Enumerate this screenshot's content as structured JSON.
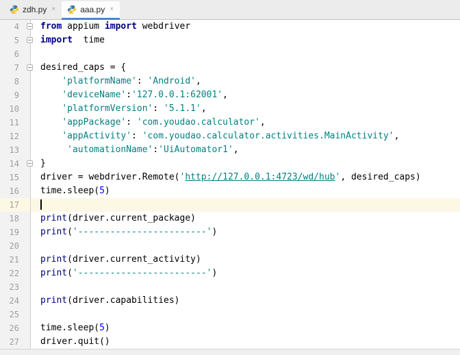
{
  "tab_bar": {
    "close_glyph": "×",
    "tabs": [
      {
        "label": "zdh.py",
        "icon": "python-file-icon",
        "active": false
      },
      {
        "label": "aaa.py",
        "icon": "python-file-icon",
        "active": true
      }
    ]
  },
  "colors": {
    "keyword": "#000080",
    "string": "#008080",
    "number": "#0000ff",
    "plain_text": "#000000",
    "line_number": "#9e9e9e",
    "current_line_bg": "#fcf8e3",
    "tab_underline": "#4a87c7",
    "tab_bar_bg": "#ececec",
    "gutter_bg": "#f2f2f2"
  },
  "editor": {
    "first_line_number": 4,
    "last_line_number": 27,
    "caret_line": 17,
    "lines": [
      {
        "number": 4,
        "fold": true,
        "segments": [
          {
            "style": "kw",
            "text": "from"
          },
          {
            "style": "plain",
            "text": " appium "
          },
          {
            "style": "kw",
            "text": "import"
          },
          {
            "style": "plain",
            "text": " webdriver"
          }
        ]
      },
      {
        "number": 5,
        "fold": true,
        "segments": [
          {
            "style": "kw",
            "text": "import"
          },
          {
            "style": "plain",
            "text": "  time"
          }
        ]
      },
      {
        "number": 6,
        "segments": []
      },
      {
        "number": 7,
        "fold": true,
        "segments": [
          {
            "style": "plain",
            "text": "desired_caps = {"
          }
        ]
      },
      {
        "number": 8,
        "segments": [
          {
            "style": "plain",
            "text": "    "
          },
          {
            "style": "str",
            "text": "'platformName'"
          },
          {
            "style": "plain",
            "text": ": "
          },
          {
            "style": "str",
            "text": "'Android'"
          },
          {
            "style": "plain",
            "text": ","
          }
        ]
      },
      {
        "number": 9,
        "segments": [
          {
            "style": "plain",
            "text": "    "
          },
          {
            "style": "str",
            "text": "'deviceName'"
          },
          {
            "style": "plain",
            "text": ":"
          },
          {
            "style": "str",
            "text": "'127.0.0.1:62001'"
          },
          {
            "style": "plain",
            "text": ","
          }
        ]
      },
      {
        "number": 10,
        "segments": [
          {
            "style": "plain",
            "text": "    "
          },
          {
            "style": "str",
            "text": "'platformVersion'"
          },
          {
            "style": "plain",
            "text": ": "
          },
          {
            "style": "str",
            "text": "'5.1.1'"
          },
          {
            "style": "plain",
            "text": ","
          }
        ]
      },
      {
        "number": 11,
        "segments": [
          {
            "style": "plain",
            "text": "    "
          },
          {
            "style": "str",
            "text": "'appPackage'"
          },
          {
            "style": "plain",
            "text": ": "
          },
          {
            "style": "str",
            "text": "'com.youdao.calculator'"
          },
          {
            "style": "plain",
            "text": ","
          }
        ]
      },
      {
        "number": 12,
        "segments": [
          {
            "style": "plain",
            "text": "    "
          },
          {
            "style": "str",
            "text": "'appActivity'"
          },
          {
            "style": "plain",
            "text": ": "
          },
          {
            "style": "str",
            "text": "'com.youdao.calculator.activities.MainActivity'"
          },
          {
            "style": "plain",
            "text": ","
          }
        ]
      },
      {
        "number": 13,
        "segments": [
          {
            "style": "plain",
            "text": "     "
          },
          {
            "style": "str",
            "text": "'automationName'"
          },
          {
            "style": "plain",
            "text": ":"
          },
          {
            "style": "str",
            "text": "'UiAutomator1'"
          },
          {
            "style": "plain",
            "text": ","
          }
        ]
      },
      {
        "number": 14,
        "fold": true,
        "segments": [
          {
            "style": "plain",
            "text": "}"
          }
        ]
      },
      {
        "number": 15,
        "segments": [
          {
            "style": "plain",
            "text": "driver = webdriver.Remote("
          },
          {
            "style": "str",
            "text": "'"
          },
          {
            "style": "url",
            "text": "http://127.0.0.1:4723/wd/hub"
          },
          {
            "style": "str",
            "text": "'"
          },
          {
            "style": "plain",
            "text": ", desired_caps)"
          }
        ]
      },
      {
        "number": 16,
        "segments": [
          {
            "style": "plain",
            "text": "time.sleep("
          },
          {
            "style": "num",
            "text": "5"
          },
          {
            "style": "plain",
            "text": ")"
          }
        ]
      },
      {
        "number": 17,
        "current": true,
        "caret": true,
        "segments": []
      },
      {
        "number": 18,
        "segments": [
          {
            "style": "builtin",
            "text": "print"
          },
          {
            "style": "plain",
            "text": "(driver.current_package)"
          }
        ]
      },
      {
        "number": 19,
        "segments": [
          {
            "style": "builtin",
            "text": "print"
          },
          {
            "style": "plain",
            "text": "("
          },
          {
            "style": "str",
            "text": "'------------------------'"
          },
          {
            "style": "plain",
            "text": ")"
          }
        ]
      },
      {
        "number": 20,
        "segments": []
      },
      {
        "number": 21,
        "segments": [
          {
            "style": "builtin",
            "text": "print"
          },
          {
            "style": "plain",
            "text": "(driver.current_activity)"
          }
        ]
      },
      {
        "number": 22,
        "segments": [
          {
            "style": "builtin",
            "text": "print"
          },
          {
            "style": "plain",
            "text": "("
          },
          {
            "style": "str",
            "text": "'------------------------'"
          },
          {
            "style": "plain",
            "text": ")"
          }
        ]
      },
      {
        "number": 23,
        "segments": []
      },
      {
        "number": 24,
        "segments": [
          {
            "style": "builtin",
            "text": "print"
          },
          {
            "style": "plain",
            "text": "(driver.capabilities)"
          }
        ]
      },
      {
        "number": 25,
        "segments": []
      },
      {
        "number": 26,
        "segments": [
          {
            "style": "plain",
            "text": "time.sleep("
          },
          {
            "style": "num",
            "text": "5"
          },
          {
            "style": "plain",
            "text": ")"
          }
        ]
      },
      {
        "number": 27,
        "segments": [
          {
            "style": "plain",
            "text": "driver.quit()"
          }
        ]
      }
    ]
  }
}
